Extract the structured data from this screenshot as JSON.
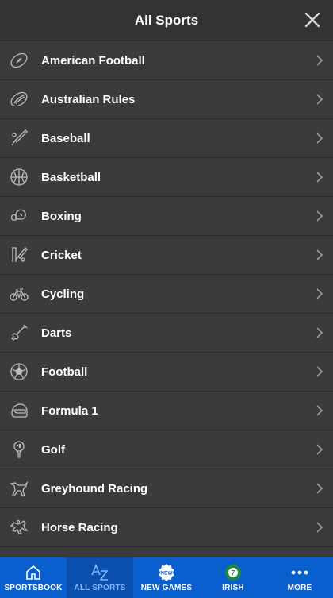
{
  "header": {
    "title": "All Sports"
  },
  "sports": [
    {
      "label": "American Football",
      "icon": "american-football-icon"
    },
    {
      "label": "Australian Rules",
      "icon": "australian-rules-icon"
    },
    {
      "label": "Baseball",
      "icon": "baseball-icon"
    },
    {
      "label": "Basketball",
      "icon": "basketball-icon"
    },
    {
      "label": "Boxing",
      "icon": "boxing-icon"
    },
    {
      "label": "Cricket",
      "icon": "cricket-icon"
    },
    {
      "label": "Cycling",
      "icon": "cycling-icon"
    },
    {
      "label": "Darts",
      "icon": "darts-icon"
    },
    {
      "label": "Football",
      "icon": "football-icon"
    },
    {
      "label": "Formula 1",
      "icon": "formula1-icon"
    },
    {
      "label": "Golf",
      "icon": "golf-icon"
    },
    {
      "label": "Greyhound Racing",
      "icon": "greyhound-icon"
    },
    {
      "label": "Horse Racing",
      "icon": "horse-racing-icon"
    }
  ],
  "nav": {
    "sportsbook": "SPORTSBOOK",
    "all_sports": "ALL SPORTS",
    "new_games": "NEW GAMES",
    "new_badge": "NEW",
    "irish": "IRISH",
    "irish_badge": "7",
    "more": "MORE"
  },
  "colors": {
    "nav_bg": "#0a5fcf",
    "nav_active": "#0a4fae",
    "list_bg": "#3b3b3b"
  }
}
